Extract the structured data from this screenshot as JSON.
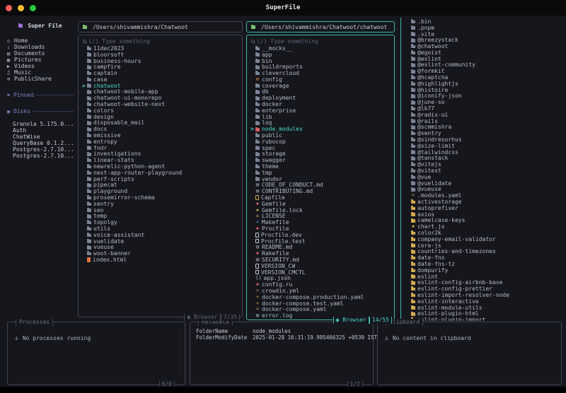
{
  "window": {
    "title": "SuperFile"
  },
  "traffic_lights": {
    "close": "#ff5f57",
    "minimize": "#febc2e",
    "zoom": "#28c840"
  },
  "sidebar": {
    "title": "Super File",
    "items": [
      {
        "label": "Home",
        "icon": "home"
      },
      {
        "label": "Downloads",
        "icon": "download"
      },
      {
        "label": "Documents",
        "icon": "document"
      },
      {
        "label": "Pictures",
        "icon": "picture"
      },
      {
        "label": "Videos",
        "icon": "video"
      },
      {
        "label": "Music",
        "icon": "music"
      },
      {
        "label": "PublicShare",
        "icon": "globe"
      }
    ],
    "pinned_label": "Pinned",
    "disks_label": "Disks",
    "disks": [
      "Granola 5.175.0...",
      "Auth",
      "ChatWise",
      "QueryBase 0.1.2...",
      "Postgres-2.7.10...",
      "Postgres-2.7.10..."
    ]
  },
  "panels": [
    {
      "path": "/Users/shivammishra/Chatwoot",
      "search_placeholder": "(/) Type something",
      "mode_label": "◉ Browser",
      "counter": "7/35",
      "files": [
        {
          "n": "11dec2023",
          "i": "folder"
        },
        {
          "n": "bloorsoft",
          "i": "folder"
        },
        {
          "n": "business-hours",
          "i": "folder"
        },
        {
          "n": "campfire",
          "i": "folder"
        },
        {
          "n": "captain",
          "i": "folder"
        },
        {
          "n": "casa",
          "i": "folder"
        },
        {
          "n": "chatwoot",
          "i": "folder",
          "sel": true
        },
        {
          "n": "chatwoot-mobile-app",
          "i": "folder"
        },
        {
          "n": "chatwoot-ui-monorepo",
          "i": "folder"
        },
        {
          "n": "chatwoot-website-next",
          "i": "folder"
        },
        {
          "n": "colors",
          "i": "folder"
        },
        {
          "n": "design",
          "i": "folder"
        },
        {
          "n": "disposable_mail",
          "i": "folder"
        },
        {
          "n": "docs",
          "i": "folder"
        },
        {
          "n": "emissive",
          "i": "folder"
        },
        {
          "n": "entropy",
          "i": "folder"
        },
        {
          "n": "fndr",
          "i": "folder"
        },
        {
          "n": "investigations",
          "i": "folder"
        },
        {
          "n": "linear-stats",
          "i": "folder"
        },
        {
          "n": "newrelic-python-agent",
          "i": "folder"
        },
        {
          "n": "next-app-router-playground",
          "i": "folder"
        },
        {
          "n": "perf-scripts",
          "i": "folder"
        },
        {
          "n": "pipecat",
          "i": "folder"
        },
        {
          "n": "playground",
          "i": "folder"
        },
        {
          "n": "prosemirror-schema",
          "i": "folder"
        },
        {
          "n": "sentry",
          "i": "folder"
        },
        {
          "n": "seo",
          "i": "folder"
        },
        {
          "n": "temp",
          "i": "folder"
        },
        {
          "n": "topolgy",
          "i": "folder"
        },
        {
          "n": "utils",
          "i": "folder"
        },
        {
          "n": "voice-assistant",
          "i": "folder"
        },
        {
          "n": "vuelidate",
          "i": "folder"
        },
        {
          "n": "vueuse",
          "i": "folder"
        },
        {
          "n": "woot-banner",
          "i": "folder"
        },
        {
          "n": "index.html",
          "i": "html"
        }
      ]
    },
    {
      "path": "/Users/shivammishra/Chatwoot/chatwoot",
      "search_placeholder": "(/) Type something",
      "mode_label": "◉ Browser",
      "counter": "14/55",
      "files": [
        {
          "n": "__mocks__",
          "i": "folder"
        },
        {
          "n": "app",
          "i": "folder"
        },
        {
          "n": "bin",
          "i": "folder"
        },
        {
          "n": "buildreports",
          "i": "folder"
        },
        {
          "n": "clevercloud",
          "i": "folder"
        },
        {
          "n": "config",
          "i": "gear"
        },
        {
          "n": "coverage",
          "i": "folder"
        },
        {
          "n": "db",
          "i": "folder"
        },
        {
          "n": "deployment",
          "i": "folder"
        },
        {
          "n": "docker",
          "i": "folder"
        },
        {
          "n": "enterprise",
          "i": "folder"
        },
        {
          "n": "lib",
          "i": "folder"
        },
        {
          "n": "log",
          "i": "folder"
        },
        {
          "n": "node_modules",
          "i": "folder-red",
          "sel": true
        },
        {
          "n": "public",
          "i": "folder"
        },
        {
          "n": "rubocop",
          "i": "folder"
        },
        {
          "n": "spec",
          "i": "folder"
        },
        {
          "n": "storage",
          "i": "folder"
        },
        {
          "n": "swagger",
          "i": "folder"
        },
        {
          "n": "theme",
          "i": "folder"
        },
        {
          "n": "tmp",
          "i": "folder"
        },
        {
          "n": "vendor",
          "i": "folder"
        },
        {
          "n": "CODE_OF_CONDUCT.md",
          "i": "md"
        },
        {
          "n": "CONTRIBUTING.md",
          "i": "md"
        },
        {
          "n": "Capfile",
          "i": "file-amber"
        },
        {
          "n": "Gemfile",
          "i": "ruby"
        },
        {
          "n": "Gemfile.lock",
          "i": "lock"
        },
        {
          "n": "LICENSE",
          "i": "license"
        },
        {
          "n": "Makefile",
          "i": "make"
        },
        {
          "n": "Procfile",
          "i": "ruby"
        },
        {
          "n": "Procfile.dev",
          "i": "file"
        },
        {
          "n": "Procfile.test",
          "i": "file"
        },
        {
          "n": "README.md",
          "i": "md"
        },
        {
          "n": "Rakefile",
          "i": "ruby"
        },
        {
          "n": "SECURITY.md",
          "i": "md"
        },
        {
          "n": "VERSION_CW",
          "i": "file"
        },
        {
          "n": "VERSION_CMCTL",
          "i": "file"
        },
        {
          "n": "app.json",
          "i": "json"
        },
        {
          "n": "config.ru",
          "i": "ruby"
        },
        {
          "n": "crowdin.yml",
          "i": "yaml"
        },
        {
          "n": "docker-compose.production.yaml",
          "i": "yaml"
        },
        {
          "n": "docker-compose.test.yaml",
          "i": "yaml"
        },
        {
          "n": "docker-compose.yaml",
          "i": "yaml"
        },
        {
          "n": "error.log",
          "i": "log"
        }
      ]
    }
  ],
  "preview": {
    "files": [
      {
        "n": ".bin",
        "i": "folder"
      },
      {
        "n": ".pnpm",
        "i": "folder"
      },
      {
        "n": ".vite",
        "i": "folder"
      },
      {
        "n": "@breezystack",
        "i": "folder"
      },
      {
        "n": "@chatwoot",
        "i": "folder"
      },
      {
        "n": "@egoist",
        "i": "folder"
      },
      {
        "n": "@eslint",
        "i": "folder"
      },
      {
        "n": "@eslint-community",
        "i": "folder"
      },
      {
        "n": "@formkit",
        "i": "folder"
      },
      {
        "n": "@hcaptcha",
        "i": "folder"
      },
      {
        "n": "@highlightjs",
        "i": "folder"
      },
      {
        "n": "@histoire",
        "i": "folder"
      },
      {
        "n": "@iconify-json",
        "i": "folder"
      },
      {
        "n": "@june-so",
        "i": "folder"
      },
      {
        "n": "@lk77",
        "i": "folder"
      },
      {
        "n": "@radix-ui",
        "i": "folder"
      },
      {
        "n": "@rails",
        "i": "folder"
      },
      {
        "n": "@scmmishra",
        "i": "folder"
      },
      {
        "n": "@sentry",
        "i": "folder"
      },
      {
        "n": "@sindresorhus",
        "i": "folder"
      },
      {
        "n": "@size-limit",
        "i": "folder"
      },
      {
        "n": "@tailwindcss",
        "i": "folder"
      },
      {
        "n": "@tanstack",
        "i": "folder"
      },
      {
        "n": "@vitejs",
        "i": "folder"
      },
      {
        "n": "@vitest",
        "i": "folder"
      },
      {
        "n": "@vue",
        "i": "folder"
      },
      {
        "n": "@vuelidate",
        "i": "folder"
      },
      {
        "n": "@vueuse",
        "i": "folder"
      },
      {
        "n": ".modules.yaml",
        "i": "yaml"
      },
      {
        "n": "activestorage",
        "i": "folder-amber"
      },
      {
        "n": "autoprefixer",
        "i": "folder-amber"
      },
      {
        "n": "axios",
        "i": "folder-amber"
      },
      {
        "n": "camelcase-keys",
        "i": "folder-amber"
      },
      {
        "n": "chart.js",
        "i": "js"
      },
      {
        "n": "color2k",
        "i": "folder-amber"
      },
      {
        "n": "company-email-validator",
        "i": "folder-amber"
      },
      {
        "n": "core-js",
        "i": "folder-amber"
      },
      {
        "n": "countries-and-timezones",
        "i": "folder-amber"
      },
      {
        "n": "date-fns",
        "i": "folder-amber"
      },
      {
        "n": "date-fns-tz",
        "i": "folder-amber"
      },
      {
        "n": "dompurify",
        "i": "folder-amber"
      },
      {
        "n": "eslint",
        "i": "folder-amber"
      },
      {
        "n": "eslint-config-airbnb-base",
        "i": "folder-amber"
      },
      {
        "n": "eslint-config-prettier",
        "i": "folder-amber"
      },
      {
        "n": "eslint-import-resolver-node",
        "i": "folder-amber"
      },
      {
        "n": "eslint-interactive",
        "i": "folder-amber"
      },
      {
        "n": "eslint-module-utils",
        "i": "folder-amber"
      },
      {
        "n": "eslint-plugin-html",
        "i": "folder-amber"
      },
      {
        "n": "eslint-plugin-import",
        "i": "folder-amber"
      }
    ]
  },
  "bottom": {
    "processes": {
      "title": "Processes",
      "empty": "No processes running",
      "counter": "0/0"
    },
    "metadata": {
      "title": "Metadata",
      "rows": [
        {
          "key": "FolderName",
          "value": "node_modules"
        },
        {
          "key": "FolderModifyDate",
          "value": "2025-01-28 16:31:19.905466325 +0530 IST"
        }
      ],
      "counter": "1/2"
    },
    "clipboard": {
      "title": "Clipboard",
      "empty": "No content in clipboard"
    }
  },
  "colors": {
    "bg": "#15171d",
    "titlebar": "#0a0a0b",
    "border": "#3e4450",
    "accent": "#3fb9ab",
    "text": "#b4bac6",
    "muted": "#5d6575",
    "selected": "#4fd6c9",
    "path_text": "#c9d2d6",
    "header_folder": "#7cc36d",
    "section": "#7f84c6",
    "logo_folder": "#a06cd5"
  },
  "icon_colors": {
    "folder": "#7b8597",
    "folder-red": "#cf5c5c",
    "folder-amber": "#d3a94f",
    "gear": "#d98f3d",
    "md": "#9aa3b2",
    "file": "#c6cbd4",
    "file-amber": "#d3a94f",
    "ruby": "#d9596e",
    "lock": "#d3a94f",
    "license": "#d3a94f",
    "make": "#5b9bd5",
    "json": "#9aa3b2",
    "yaml": "#d3a94f",
    "html": "#e0733d",
    "js": "#e2b93d",
    "log": "#9aa3b2"
  }
}
